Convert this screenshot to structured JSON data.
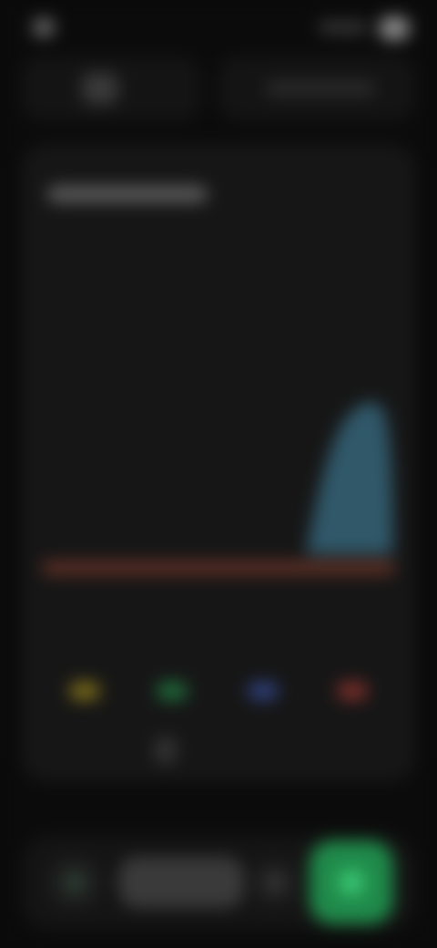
{
  "colors": {
    "background": "#0b0b0b",
    "card": "#161616",
    "baseline": "#7a3a2a",
    "area_fill": "#3a6f86",
    "legend_yellow": "#7a6a1a",
    "legend_green": "#1f6a3a",
    "legend_blue": "#2f3f7a",
    "legend_red": "#7a2f2a",
    "primary_action": "#1f8a4a"
  },
  "status_bar": {
    "time": "",
    "icons": [
      "signal-icon",
      "wifi-icon",
      "battery-icon"
    ]
  },
  "top_tabs": [
    {
      "label": "",
      "icon": "chart-icon"
    },
    {
      "label": "",
      "icon": "calendar-icon"
    }
  ],
  "card": {
    "title": ""
  },
  "day_labels": [
    "",
    "",
    "",
    "",
    ""
  ],
  "legend": [
    {
      "label": "",
      "color": "#7a6a1a"
    },
    {
      "label": "",
      "color": "#1f6a3a"
    },
    {
      "label": "",
      "color": "#2f3f7a"
    },
    {
      "label": "",
      "color": "#7a2f2a"
    }
  ],
  "bottom_nav": {
    "middle_label": "",
    "items": [
      "home-icon",
      "nav-middle",
      "list-icon",
      "add-icon"
    ]
  }
}
